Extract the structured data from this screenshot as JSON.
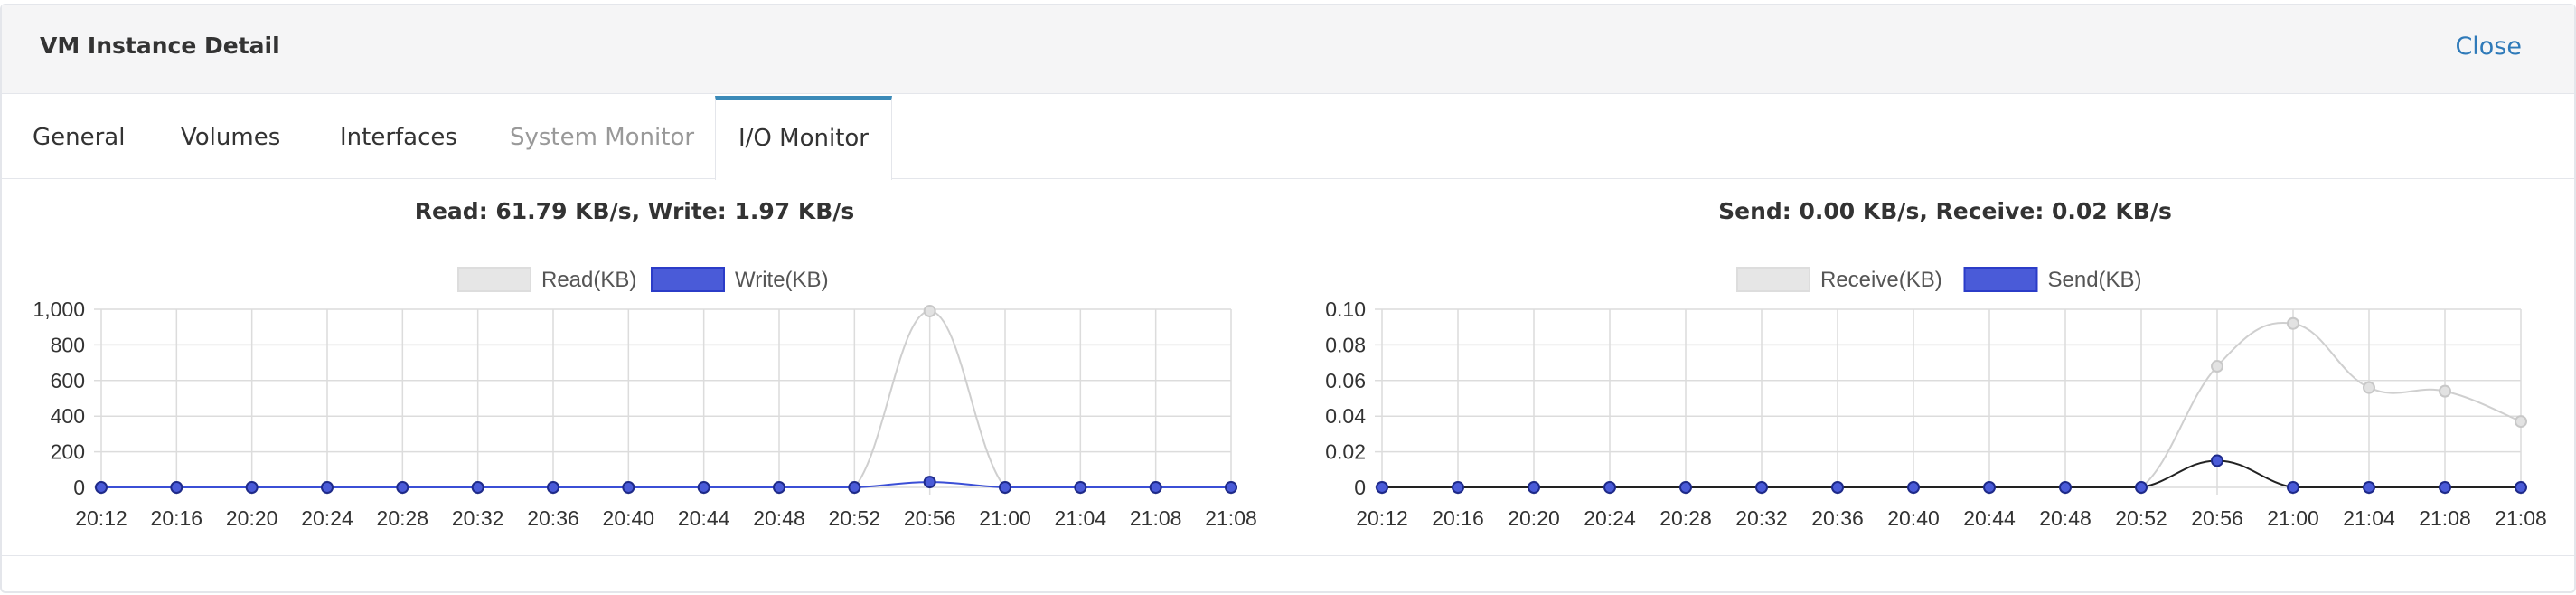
{
  "window": {
    "title": "VM Instance Detail",
    "close_label": "Close"
  },
  "tabs": [
    {
      "label": "General",
      "state": "normal"
    },
    {
      "label": "Volumes",
      "state": "normal"
    },
    {
      "label": "Interfaces",
      "state": "normal"
    },
    {
      "label": "System Monitor",
      "state": "disabled"
    },
    {
      "label": "I/O Monitor",
      "state": "active"
    }
  ],
  "colors": {
    "accent": "#3b8ab8",
    "link": "#2f7ab9",
    "series_light": "#d6d6d6",
    "series_blue": "#3b4fd6"
  },
  "chart_data": [
    {
      "type": "line",
      "title": "Read: 61.79 KB/s, Write: 1.97 KB/s",
      "x": [
        "20:12",
        "20:16",
        "20:20",
        "20:24",
        "20:28",
        "20:32",
        "20:36",
        "20:40",
        "20:44",
        "20:48",
        "20:52",
        "20:56",
        "21:00",
        "21:04",
        "21:08",
        "21:08"
      ],
      "series": [
        {
          "name": "Read(KB)",
          "color": "#cfcfcf",
          "fill": "#e6e6e6",
          "values": [
            0,
            0,
            0,
            0,
            0,
            0,
            0,
            0,
            0,
            0,
            0,
            990,
            0,
            0,
            0,
            0
          ]
        },
        {
          "name": "Write(KB)",
          "color": "#3b4fd6",
          "fill": "#4a5bd8",
          "values": [
            0,
            0,
            0,
            0,
            0,
            0,
            0,
            0,
            0,
            0,
            0,
            30,
            0,
            0,
            0,
            0
          ]
        }
      ],
      "ylim": [
        0,
        1000
      ],
      "yticks": [
        "1,000",
        "800",
        "600",
        "400",
        "200",
        "0"
      ],
      "legend": "top-center",
      "grid": true
    },
    {
      "type": "line",
      "title": "Send: 0.00 KB/s, Receive: 0.02 KB/s",
      "x": [
        "20:12",
        "20:16",
        "20:20",
        "20:24",
        "20:28",
        "20:32",
        "20:36",
        "20:40",
        "20:44",
        "20:48",
        "20:52",
        "20:56",
        "21:00",
        "21:04",
        "21:08",
        "21:08"
      ],
      "series": [
        {
          "name": "Receive(KB)",
          "color": "#cfcfcf",
          "fill": "#e6e6e6",
          "values": [
            0,
            0,
            0,
            0,
            0,
            0,
            0,
            0,
            0,
            0,
            0,
            0.068,
            0.092,
            0.056,
            0.054,
            0.037
          ]
        },
        {
          "name": "Send(KB)",
          "color": "#222222",
          "fill": "#4a5bd8",
          "values": [
            0,
            0,
            0,
            0,
            0,
            0,
            0,
            0,
            0,
            0,
            0,
            0.015,
            0,
            0,
            0,
            0
          ]
        }
      ],
      "ylim": [
        0,
        0.1
      ],
      "yticks": [
        "0.10",
        "0.08",
        "0.06",
        "0.04",
        "0.02",
        "0"
      ],
      "legend": "top-center",
      "grid": true
    }
  ]
}
